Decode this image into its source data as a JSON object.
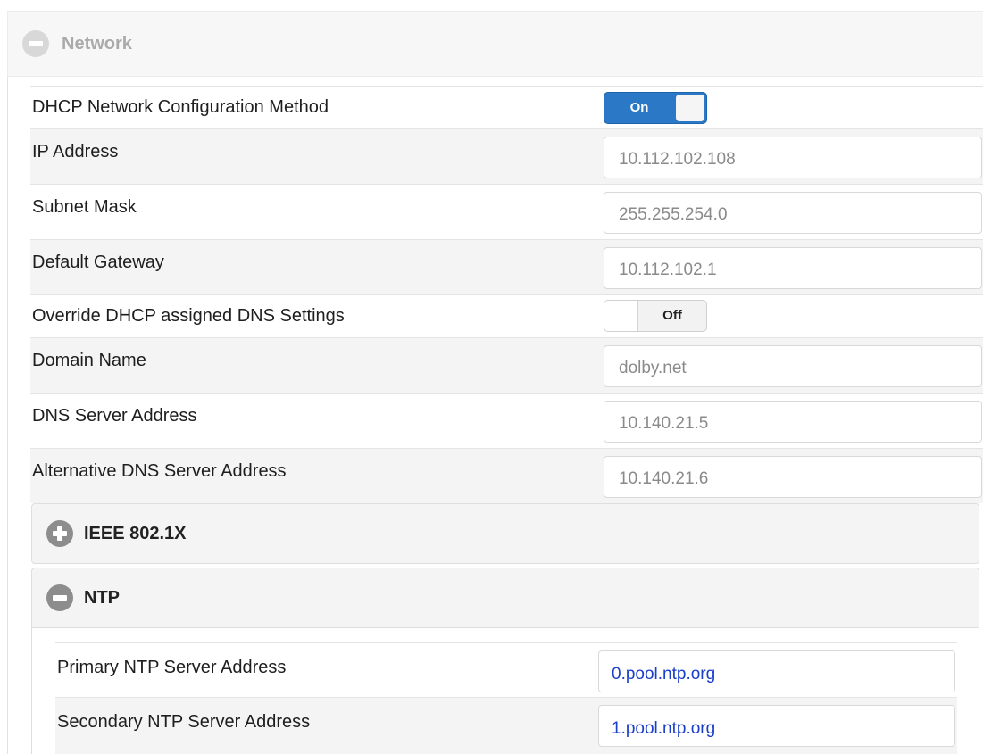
{
  "network": {
    "title": "Network",
    "rows": [
      {
        "label": "DHCP Network Configuration Method",
        "type": "toggle",
        "state": "On"
      },
      {
        "label": "IP Address",
        "type": "field",
        "value": "10.112.102.108"
      },
      {
        "label": "Subnet Mask",
        "type": "field",
        "value": "255.255.254.0"
      },
      {
        "label": "Default Gateway",
        "type": "field",
        "value": "10.112.102.1"
      },
      {
        "label": "Override DHCP assigned DNS Settings",
        "type": "toggle",
        "state": "Off"
      },
      {
        "label": "Domain Name",
        "type": "field",
        "value": "dolby.net"
      },
      {
        "label": "DNS Server Address",
        "type": "field",
        "value": "10.140.21.5"
      },
      {
        "label": "Alternative DNS Server Address",
        "type": "field",
        "value": "10.140.21.6"
      }
    ]
  },
  "ieee": {
    "title": "IEEE 802.1X",
    "icon": "plus-circle-icon"
  },
  "ntp": {
    "title": "NTP",
    "icon": "minus-circle-icon",
    "rows": [
      {
        "label": "Primary NTP Server Address",
        "value": "0.pool.ntp.org"
      },
      {
        "label": "Secondary NTP Server Address",
        "value": "1.pool.ntp.org"
      }
    ]
  },
  "colors": {
    "toggle_on": "#2b78c7",
    "ntp_value_text": "#1a3fc9",
    "readonly_value_text": "#8a8a8a"
  }
}
